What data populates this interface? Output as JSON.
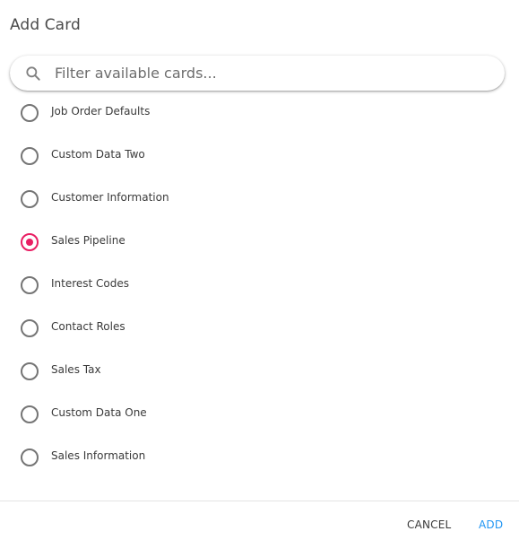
{
  "dialog": {
    "title": "Add Card"
  },
  "search": {
    "icon": "search-icon",
    "placeholder": "Filter available cards..."
  },
  "cards": [
    {
      "label": "Job Order Defaults",
      "selected": false
    },
    {
      "label": "Custom Data Two",
      "selected": false
    },
    {
      "label": "Customer Information",
      "selected": false
    },
    {
      "label": "Sales Pipeline",
      "selected": true
    },
    {
      "label": "Interest Codes",
      "selected": false
    },
    {
      "label": "Contact Roles",
      "selected": false
    },
    {
      "label": "Sales Tax",
      "selected": false
    },
    {
      "label": "Custom Data One",
      "selected": false
    },
    {
      "label": "Sales Information",
      "selected": false
    }
  ],
  "actions": {
    "cancel_label": "CANCEL",
    "add_label": "ADD"
  },
  "colors": {
    "accent": "#e91e63",
    "primary_action": "#2196f3",
    "radio_border": "#757575"
  }
}
